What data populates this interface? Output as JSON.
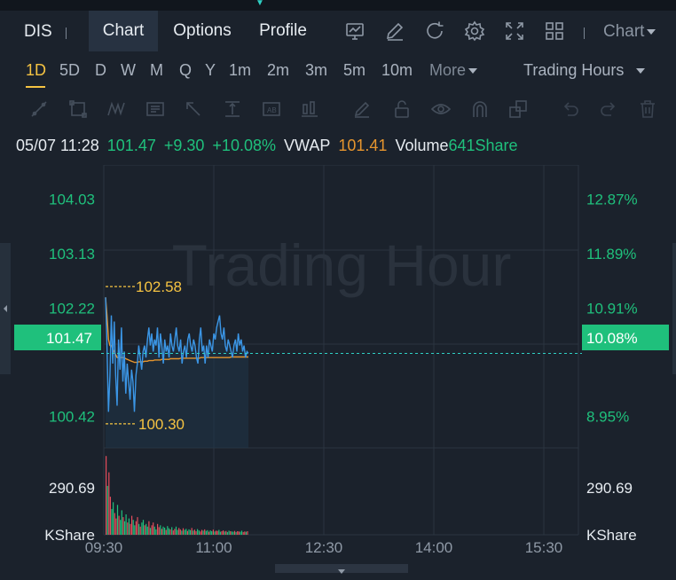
{
  "header": {
    "ticker": "DIS",
    "tabs": [
      {
        "label": "Chart",
        "active": true
      },
      {
        "label": "Options",
        "active": false
      },
      {
        "label": "Profile",
        "active": false
      }
    ],
    "icons": [
      "indicator-icon",
      "draw-icon",
      "refresh-icon",
      "settings-icon",
      "fullscreen-icon",
      "grid-layout-icon"
    ],
    "chart_type_label": "Chart"
  },
  "timeframes": {
    "items": [
      "1D",
      "5D",
      "D",
      "W",
      "M",
      "Q",
      "Y",
      "1m",
      "2m",
      "3m",
      "5m",
      "10m"
    ],
    "active": "1D",
    "more_label": "More",
    "session_label": "Trading Hours"
  },
  "tools": [
    "trendline-icon",
    "rectangle-icon",
    "pattern-icon",
    "text-note-icon",
    "arrow-icon",
    "price-range-icon",
    "annotation-icon",
    "bar-measure-icon",
    "pen-icon",
    "lock-icon",
    "eye-icon",
    "magnet-icon",
    "duplicate-icon",
    "undo-icon",
    "redo-icon",
    "trash-icon"
  ],
  "quote": {
    "datetime": "05/07 11:28",
    "price": "101.47",
    "change": "+9.30",
    "change_pct": "+10.08%",
    "vwap_label": "VWAP",
    "vwap": "101.41",
    "volume_label": "Volume",
    "volume": "641Share"
  },
  "colors": {
    "up": "#1fc07c",
    "down": "#e54d5c",
    "accent": "#f5c342",
    "price_line": "#3b96e6",
    "vwap_line": "#e6952e",
    "bg": "#1b222c"
  },
  "chart_data": {
    "type": "line",
    "watermark": "Trading Hour",
    "price_axis": [
      "104.03",
      "103.13",
      "102.22",
      "100.42"
    ],
    "pct_axis": [
      "12.87%",
      "11.89%",
      "10.91%",
      "8.95%"
    ],
    "current_price_tag": "101.47",
    "current_pct_tag": "10.08%",
    "high_label": "102.58",
    "low_label": "100.30",
    "volume_axis_left": [
      "290.69",
      "KShare"
    ],
    "volume_axis_right": [
      "290.69",
      "KShare"
    ],
    "x_ticks": [
      "09:30",
      "11:00",
      "12:30",
      "14:00",
      "15:30"
    ],
    "ylim": [
      99.9,
      104.6
    ],
    "price": [
      102.4,
      101.6,
      100.5,
      101.1,
      102.1,
      101.3,
      102.0,
      101.1,
      100.6,
      101.7,
      101.2,
      101.9,
      101.0,
      101.5,
      100.8,
      101.3,
      101.0,
      100.7,
      101.2,
      101.0,
      100.5,
      101.1,
      101.3,
      101.6,
      101.4,
      101.2,
      101.5,
      101.6,
      101.4,
      101.7,
      101.9,
      101.6,
      101.8,
      101.5,
      101.7,
      101.6,
      101.9,
      101.4,
      101.8,
      101.6,
      101.3,
      101.7,
      101.5,
      101.6,
      101.4,
      101.8,
      101.6,
      101.5,
      101.7,
      101.9,
      101.6,
      101.5,
      101.7,
      101.3,
      101.5,
      101.6,
      101.4,
      101.7,
      101.8,
      101.6,
      101.5,
      101.7,
      101.6,
      101.4,
      101.3,
      101.7,
      101.9,
      101.5,
      101.6,
      101.3,
      101.6,
      101.4,
      101.7,
      101.6,
      101.5,
      101.8,
      101.7,
      101.9,
      102.0,
      102.1,
      101.8,
      101.7,
      101.9,
      101.6,
      101.5,
      101.7,
      101.6,
      101.5,
      101.4,
      101.6,
      101.7,
      101.5,
      101.8,
      101.6,
      101.7,
      101.5,
      101.6,
      101.4,
      101.5,
      101.47
    ],
    "vwap": [
      102.4,
      102.1,
      101.7,
      101.6,
      101.6,
      101.55,
      101.5,
      101.45,
      101.4,
      101.4,
      101.4,
      101.4,
      101.4,
      101.4,
      101.38,
      101.37,
      101.36,
      101.35,
      101.34,
      101.33,
      101.32,
      101.32,
      101.32,
      101.33,
      101.33,
      101.33,
      101.33,
      101.34,
      101.34,
      101.34,
      101.35,
      101.35,
      101.35,
      101.35,
      101.36,
      101.36,
      101.36,
      101.36,
      101.36,
      101.37,
      101.37,
      101.37,
      101.37,
      101.37,
      101.37,
      101.38,
      101.38,
      101.38,
      101.38,
      101.38,
      101.38,
      101.38,
      101.39,
      101.39,
      101.39,
      101.39,
      101.39,
      101.39,
      101.39,
      101.39,
      101.39,
      101.39,
      101.39,
      101.39,
      101.39,
      101.39,
      101.4,
      101.4,
      101.4,
      101.4,
      101.4,
      101.4,
      101.4,
      101.4,
      101.4,
      101.4,
      101.4,
      101.4,
      101.4,
      101.4,
      101.4,
      101.4,
      101.4,
      101.4,
      101.4,
      101.4,
      101.4,
      101.41,
      101.41,
      101.41,
      101.41,
      101.41,
      101.41,
      101.41,
      101.41,
      101.41,
      101.41,
      101.41,
      101.41,
      101.41
    ],
    "volume_kshare": [
      290,
      180,
      230,
      140,
      95,
      120,
      80,
      60,
      110,
      70,
      55,
      90,
      65,
      50,
      75,
      45,
      60,
      40,
      70,
      55,
      35,
      50,
      65,
      40,
      30,
      45,
      55,
      35,
      40,
      30,
      50,
      25,
      35,
      45,
      30,
      20,
      40,
      28,
      35,
      22,
      30,
      26,
      18,
      32,
      24,
      20,
      28,
      16,
      22,
      30,
      18,
      25,
      20,
      15,
      24,
      18,
      22,
      14,
      20,
      17,
      25,
      15,
      19,
      13,
      21,
      16,
      12,
      18,
      15,
      20,
      14,
      17,
      11,
      16,
      13,
      19,
      12,
      15,
      14,
      18,
      11,
      13,
      16,
      12,
      14,
      10,
      15,
      13,
      12,
      11,
      14,
      10,
      13,
      12,
      11,
      15,
      10,
      12,
      11,
      13
    ],
    "volume_ymax": 320
  }
}
